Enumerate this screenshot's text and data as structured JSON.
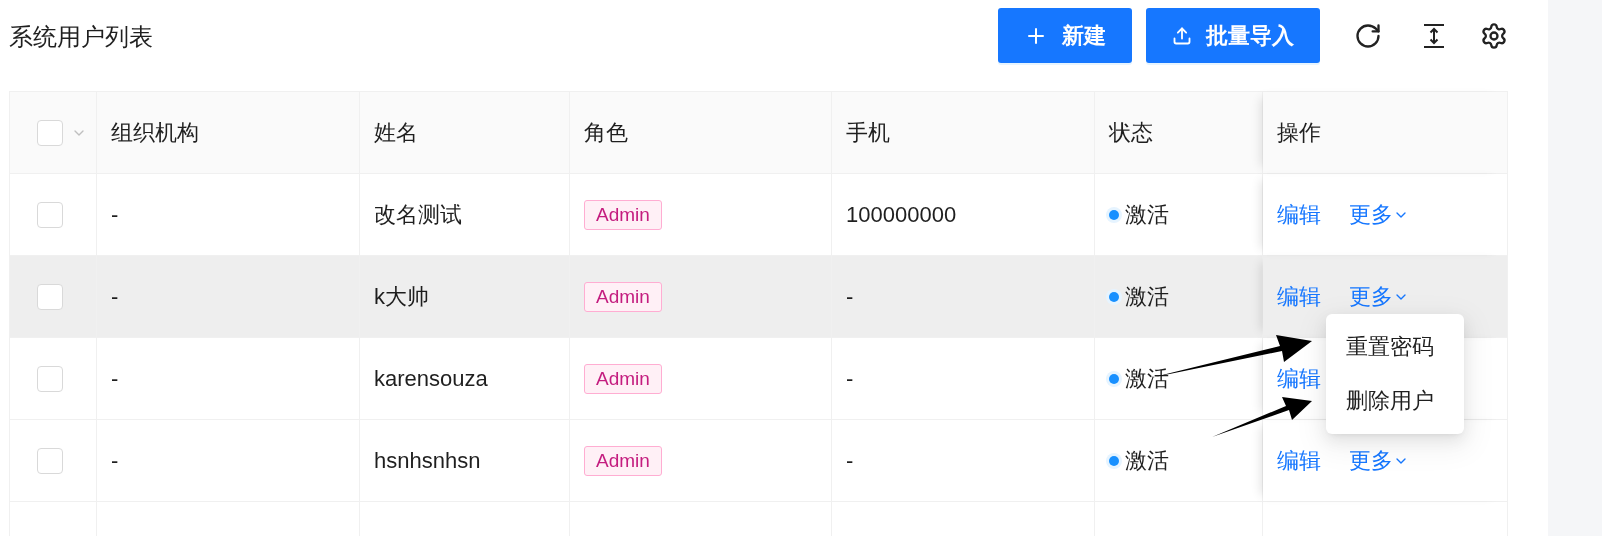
{
  "title": "系统用户列表",
  "toolbar": {
    "buttons": [
      {
        "label": "新建",
        "kind": "plus"
      },
      {
        "label": "批量导入",
        "kind": "upload"
      }
    ]
  },
  "table": {
    "select_all": {
      "checked": false
    },
    "columns": [
      "组织机构",
      "姓名",
      "角色",
      "手机",
      "状态",
      "操作"
    ],
    "rows": [
      {
        "checked": false,
        "hovered": false,
        "org": "-",
        "name": "改名测试",
        "role": "Admin",
        "phone": "100000000",
        "status": {
          "label": "激活",
          "color": "#1890ff"
        },
        "actions": {
          "edit": "编辑",
          "more": "更多"
        }
      },
      {
        "checked": false,
        "hovered": true,
        "org": "-",
        "name": "k大帅",
        "role": "Admin",
        "phone": "-",
        "status": {
          "label": "激活",
          "color": "#1890ff"
        },
        "actions": {
          "edit": "编辑",
          "more": "更多"
        }
      },
      {
        "checked": false,
        "hovered": false,
        "org": "-",
        "name": "karensouza",
        "role": "Admin",
        "phone": "-",
        "status": {
          "label": "激活",
          "color": "#1890ff"
        },
        "actions": {
          "edit": "编辑"
        }
      },
      {
        "checked": false,
        "hovered": false,
        "org": "-",
        "name": "hsnhsnhsn",
        "role": "Admin",
        "phone": "-",
        "status": {
          "label": "激活",
          "color": "#1890ff"
        },
        "actions": {
          "edit": "编辑",
          "more": "更多"
        }
      }
    ]
  },
  "dropdown": {
    "items": [
      "重置密码",
      "删除用户"
    ]
  }
}
